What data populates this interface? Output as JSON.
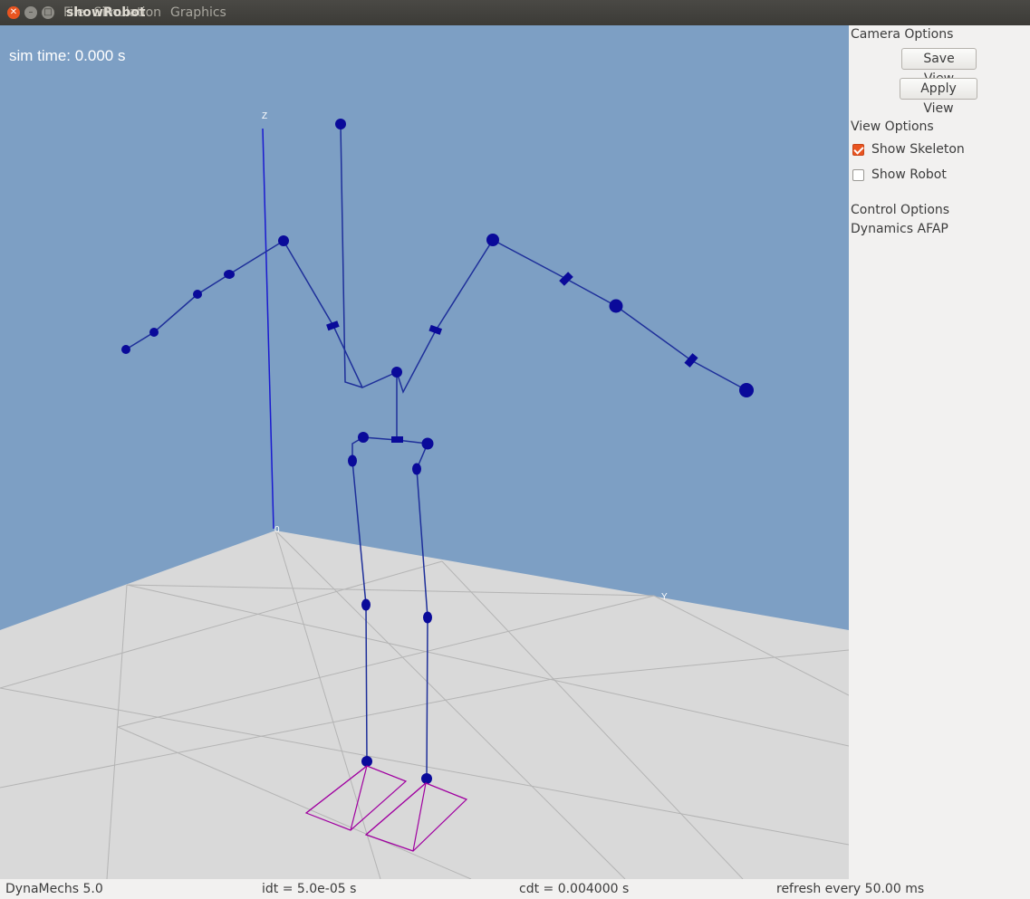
{
  "window": {
    "title": "showRobot",
    "menu": [
      "File",
      "Simulation",
      "Graphics"
    ]
  },
  "viewport": {
    "sim_time": "sim time: 0.000 s",
    "axis_labels": {
      "z": "Z",
      "origin": "0",
      "y": "Y"
    },
    "colors": {
      "sky": "#7d9fc4",
      "floor": "#d9d9d9",
      "skeleton_line": "#1a1aa8",
      "joint": "#0a0a9a",
      "foot": "#a000a0"
    }
  },
  "panel": {
    "camera_options": "Camera Options",
    "save_view": "Save View",
    "apply_view": "Apply View",
    "view_options": "View Options",
    "show_skeleton": {
      "label": "Show Skeleton",
      "checked": true
    },
    "show_robot": {
      "label": "Show Robot",
      "checked": false
    },
    "control_options": "Control Options",
    "dynamics_mode": "Dynamics AFAP"
  },
  "status": {
    "version": "DynaMechs 5.0",
    "idt": "idt = 5.0e-05 s",
    "cdt": "cdt = 0.004000 s",
    "refresh": "refresh every 50.00 ms"
  }
}
